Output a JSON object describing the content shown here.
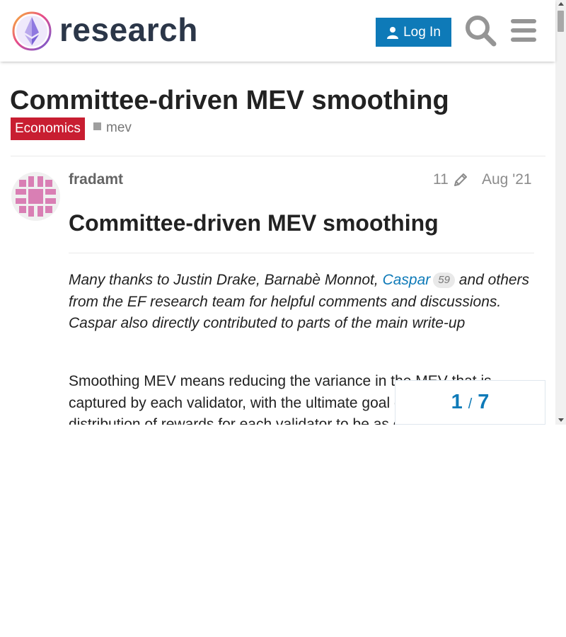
{
  "header": {
    "site_name": "research",
    "login_label": "Log In"
  },
  "topic": {
    "title": "Committee-driven MEV smoothing",
    "category": "Economics",
    "category_color": "#c81e31",
    "tag": "mev"
  },
  "post": {
    "username": "fradamt",
    "edit_count": "11",
    "date": "Aug '21",
    "heading": "Committee-driven MEV smoothing",
    "ack_before": "Many thanks to Justin Drake, Barnabè Monnot, ",
    "mention_name": "Caspar",
    "mention_count": "59",
    "ack_after": " and others from the EF research team for helpful comments and discussions. Caspar also directly contributed to parts of the main write-up",
    "body": "Smoothing MEV means reducing the variance in the MEV that is captured by each validator, with the ultimate goal of making the distribution of rewards for each validator to be as close as"
  },
  "progress": {
    "current": "1",
    "separator": "/",
    "total": "7"
  },
  "icons": {
    "login": "user-icon",
    "search": "search-icon",
    "menu": "hamburger-menu-icon",
    "edit": "pencil-icon"
  },
  "colors": {
    "accent": "#0e7ab8",
    "title_text": "#2b3648"
  }
}
